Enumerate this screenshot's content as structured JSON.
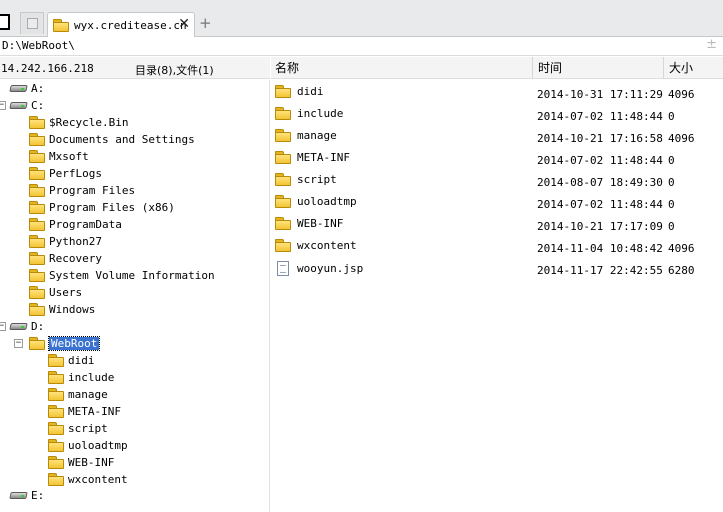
{
  "tab": {
    "title": "wyx.creditease.cn",
    "close_glyph": "✕",
    "new_glyph": "+"
  },
  "address": {
    "path": "D:\\WebRoot\\",
    "separator": "±"
  },
  "left_header": {
    "server_ip": "14.242.166.218",
    "counts": "目录(8),文件(1)"
  },
  "tree": {
    "drive_a": "A:",
    "drive_c": "C:",
    "c_children": [
      "$Recycle.Bin",
      "Documents and Settings",
      "Mxsoft",
      "PerfLogs",
      "Program Files",
      "Program Files (x86)",
      "ProgramData",
      "Python27",
      "Recovery",
      "System Volume Information",
      "Users",
      "Windows"
    ],
    "drive_d": "D:",
    "webroot": "WebRoot",
    "webroot_children": [
      "didi",
      "include",
      "manage",
      "META-INF",
      "script",
      "uoloadtmp",
      "WEB-INF",
      "wxcontent"
    ],
    "drive_e": "E:",
    "expanded_glyph": "−"
  },
  "columns": {
    "name": "名称",
    "time": "时间",
    "size": "大小"
  },
  "files": [
    {
      "name": "didi",
      "time": "2014-10-31 17:11:29",
      "size": "4096",
      "type": "folder-icon"
    },
    {
      "name": "include",
      "time": "2014-07-02 11:48:44",
      "size": "0",
      "type": "folder-icon"
    },
    {
      "name": "manage",
      "time": "2014-10-21 17:16:58",
      "size": "4096",
      "type": "folder-icon"
    },
    {
      "name": "META-INF",
      "time": "2014-07-02 11:48:44",
      "size": "0",
      "type": "folder-icon"
    },
    {
      "name": "script",
      "time": "2014-08-07 18:49:30",
      "size": "0",
      "type": "folder-icon"
    },
    {
      "name": "uoloadtmp",
      "time": "2014-07-02 11:48:44",
      "size": "0",
      "type": "folder-icon"
    },
    {
      "name": "WEB-INF",
      "time": "2014-10-21 17:17:09",
      "size": "0",
      "type": "folder-icon"
    },
    {
      "name": "wxcontent",
      "time": "2014-11-04 10:48:42",
      "size": "4096",
      "type": "folder-icon"
    },
    {
      "name": "wooyun.jsp",
      "time": "2014-11-17 22:42:55",
      "size": "6280",
      "type": "file-icon"
    }
  ],
  "colors": {
    "selection": "#3a72d2",
    "folder": "#f2c535"
  }
}
